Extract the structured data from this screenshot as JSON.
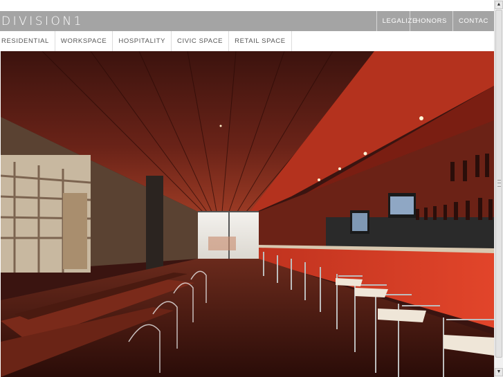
{
  "brand": {
    "logo_text": "DIVISION1"
  },
  "top_nav": {
    "items": [
      {
        "label": "LEGALIZE"
      },
      {
        "label": "HONORS"
      },
      {
        "label": "CONTAC"
      }
    ]
  },
  "sub_nav": {
    "items": [
      {
        "label": "RESIDENTIAL"
      },
      {
        "label": "WORKSPACE"
      },
      {
        "label": "HOSPITALITY"
      },
      {
        "label": "CIVIC SPACE"
      },
      {
        "label": "RETAIL SPACE"
      }
    ]
  },
  "photo": {
    "subject": "restaurant-bar-interior"
  },
  "scrollbar": {
    "up_icon": "arrow-up-icon",
    "down_icon": "arrow-down-icon"
  },
  "colors": {
    "header_bg": "#a4a4a4",
    "nav_text": "#555555",
    "bar_red": "#b8281c"
  }
}
